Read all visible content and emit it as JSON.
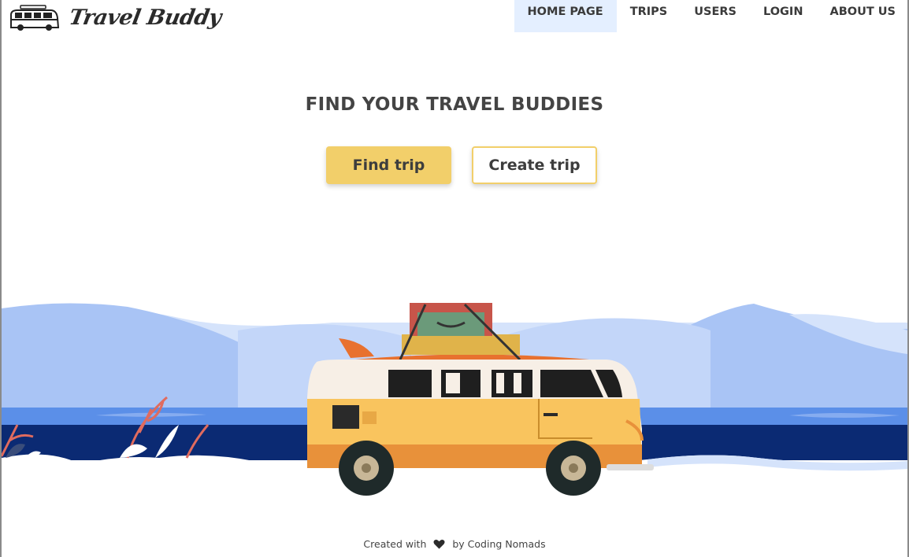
{
  "brand": {
    "name": "Travel Buddy",
    "logo_icon": "van-logo-icon"
  },
  "nav": {
    "items": [
      {
        "label": "HOME PAGE",
        "active": true
      },
      {
        "label": "TRIPS",
        "active": false
      },
      {
        "label": "USERS",
        "active": false
      },
      {
        "label": "LOGIN",
        "active": false
      },
      {
        "label": "ABOUT US",
        "active": false
      }
    ]
  },
  "hero": {
    "title": "FIND YOUR TRAVEL BUDDIES",
    "find_button": "Find trip",
    "create_button": "Create trip"
  },
  "footer": {
    "prefix": "Created with",
    "heart_icon": "heart-icon",
    "suffix": "by Coding Nomads"
  },
  "colors": {
    "accent": "#f2cf6a",
    "nav_active_bg": "#e4efff",
    "sea_dark": "#0b2a73",
    "mountain": "#a9c4f5"
  }
}
